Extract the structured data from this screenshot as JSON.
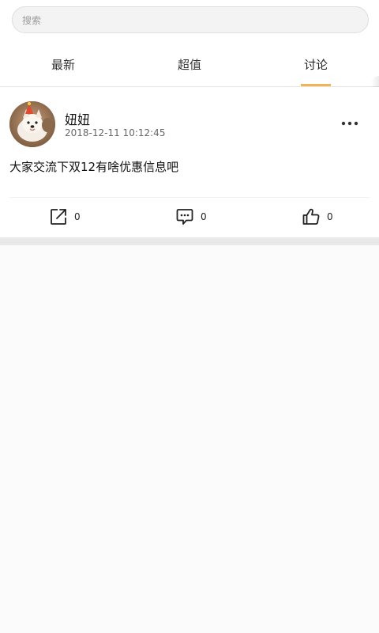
{
  "search": {
    "placeholder": "搜索",
    "value": ""
  },
  "tabs": [
    {
      "label": "最新",
      "active": false
    },
    {
      "label": "超值",
      "active": false
    },
    {
      "label": "讨论",
      "active": true
    }
  ],
  "colors": {
    "accent": "#f0b35a",
    "background": "#fbfbfb",
    "card": "#ffffff"
  },
  "post": {
    "username": "妞妞",
    "timestamp": "2018-12-11 10:12:45",
    "content": "大家交流下双12有啥优惠信息吧",
    "more_icon": "more-horizontal-icon",
    "actions": [
      {
        "icon": "share-icon",
        "count": "0"
      },
      {
        "icon": "comment-icon",
        "count": "0"
      },
      {
        "icon": "like-icon",
        "count": "0"
      }
    ]
  }
}
